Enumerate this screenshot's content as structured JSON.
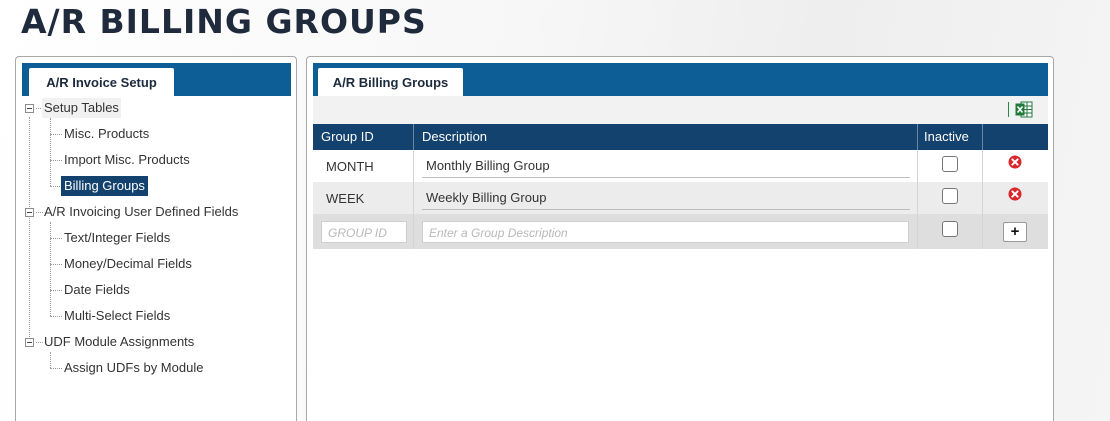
{
  "page": {
    "title": "A/R BILLING GROUPS"
  },
  "left_panel": {
    "tab_label": "A/R Invoice Setup",
    "tree": {
      "setup_tables": "Setup Tables",
      "misc_products": "Misc. Products",
      "import_misc_products": "Import Misc. Products",
      "billing_groups": "Billing Groups",
      "udf_fields": "A/R Invoicing User Defined Fields",
      "text_integer": "Text/Integer Fields",
      "money_decimal": "Money/Decimal Fields",
      "date_fields": "Date Fields",
      "multi_select": "Multi-Select Fields",
      "udf_module_assignments": "UDF Module Assignments",
      "assign_udfs": "Assign UDFs by Module"
    }
  },
  "right_panel": {
    "tab_label": "A/R Billing Groups",
    "toolbar": {
      "export_icon": "excel-icon",
      "export_color": "#1f7a3c"
    },
    "grid": {
      "columns": [
        "Group ID",
        "Description",
        "Inactive",
        ""
      ],
      "rows": [
        {
          "group_id": "MONTH",
          "description": "Monthly Billing Group",
          "inactive": false
        },
        {
          "group_id": "WEEK",
          "description": "Weekly Billing Group",
          "inactive": false
        }
      ],
      "new_row": {
        "group_id_placeholder": "GROUP ID",
        "description_placeholder": "Enter a Group Description",
        "inactive": false,
        "add_label": "+"
      }
    }
  },
  "colors": {
    "header_blue": "#0d5e96",
    "grid_header": "#14426e",
    "delete_red": "#d8262b"
  }
}
